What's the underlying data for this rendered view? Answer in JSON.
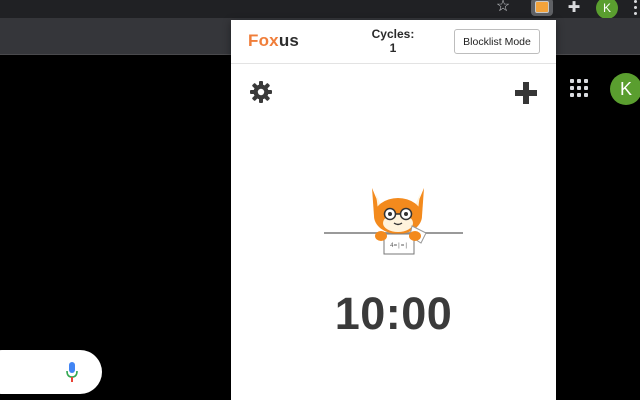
{
  "browser": {
    "profile_initial": "K",
    "accent_green": "#5a9e2f"
  },
  "popup": {
    "brand": {
      "part1": "Fox",
      "part2": "us",
      "part1_color": "#f07e3a"
    },
    "cycles": {
      "label": "Cycles:",
      "value": "1"
    },
    "mode_button": "Blocklist Mode",
    "timer": "10:00",
    "icons": {
      "settings": "gear-icon",
      "add": "plus-icon",
      "mascot": "fox-mascot"
    }
  },
  "page": {
    "profile_initial": "K"
  }
}
